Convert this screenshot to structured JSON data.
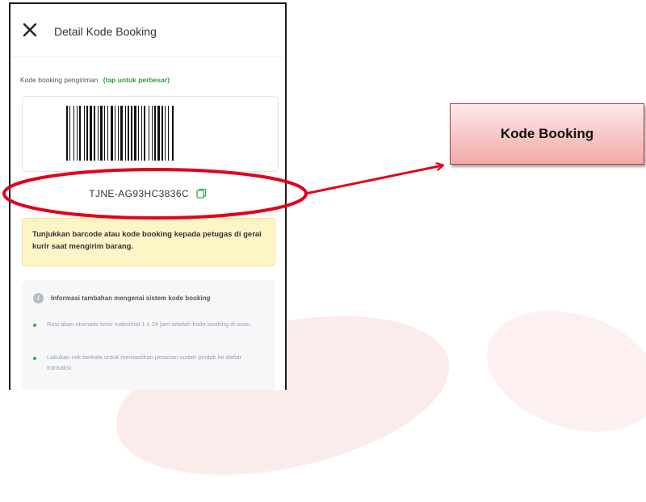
{
  "header": {
    "title": "Detail Kode Booking"
  },
  "booking": {
    "label": "Kode booking pengiriman",
    "hint": "(tap untuk perbesar)",
    "code": "TJNE-AG93HC3836C"
  },
  "notice": {
    "text": "Tunjukkan barcode atau kode booking kepada petugas di gerai kurir saat mengirim barang."
  },
  "info": {
    "title": "Informasi tambahan mengenai sistem kode booking",
    "bullets": [
      "Resi akan otomatis terisi maksimal 1 x 24 jam setelah kode booking di-scan.",
      "Lakukan cek berkala untuk memastikan pesanan sudah pindah ke daftar transaksi."
    ]
  },
  "callout": {
    "label": "Kode Booking"
  },
  "colors": {
    "accent_green": "#2e9e3a",
    "highlight_red": "#e3001b",
    "notice_bg": "#fdf5c6"
  },
  "icons": {
    "close": "close-icon",
    "copy": "copy-icon",
    "info": "info-icon"
  }
}
